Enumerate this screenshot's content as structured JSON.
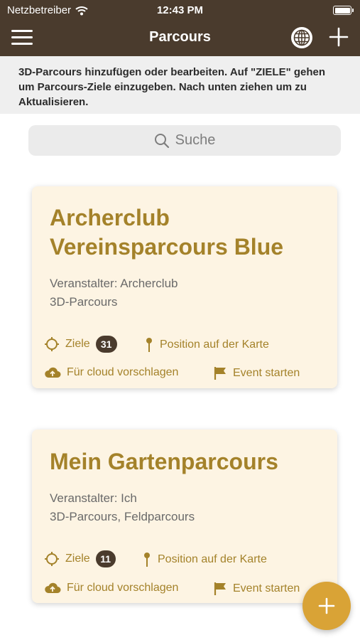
{
  "status_bar": {
    "carrier": "Netzbetreiber",
    "time": "12:43 PM"
  },
  "nav": {
    "title": "Parcours"
  },
  "info_text": "3D-Parcours hinzufügen oder bearbeiten. Auf \"ZIELE\" gehen um Parcours-Ziele einzugeben. Nach unten ziehen um zu Aktualisieren.",
  "search": {
    "placeholder": "Suche"
  },
  "cards": [
    {
      "title": "Archerclub Vereinsparcours Blue",
      "organizer": "Veranstalter: Archerclub",
      "type": "3D-Parcours",
      "targets_label": "Ziele",
      "targets_count": "31",
      "map_label": "Position auf der Karte",
      "cloud_label": "Für cloud vorschlagen",
      "event_label": "Event starten"
    },
    {
      "title": "Mein Gartenparcours",
      "organizer": "Veranstalter: Ich",
      "type": "3D-Parcours, Feldparcours",
      "targets_label": "Ziele",
      "targets_count": "11",
      "map_label": "Position auf der Karte",
      "cloud_label": "Für cloud vorschlagen",
      "event_label": "Event starten"
    }
  ],
  "colors": {
    "header": "#4a3b2d",
    "accent": "#a4822a",
    "card_bg": "#fdf4e3",
    "fab": "#d9a336"
  },
  "icons": [
    "wifi-icon",
    "battery-icon",
    "menu-icon",
    "globe-icon",
    "plus-icon",
    "search-icon",
    "crosshair-icon",
    "pin-icon",
    "cloud-upload-icon",
    "flag-icon"
  ]
}
